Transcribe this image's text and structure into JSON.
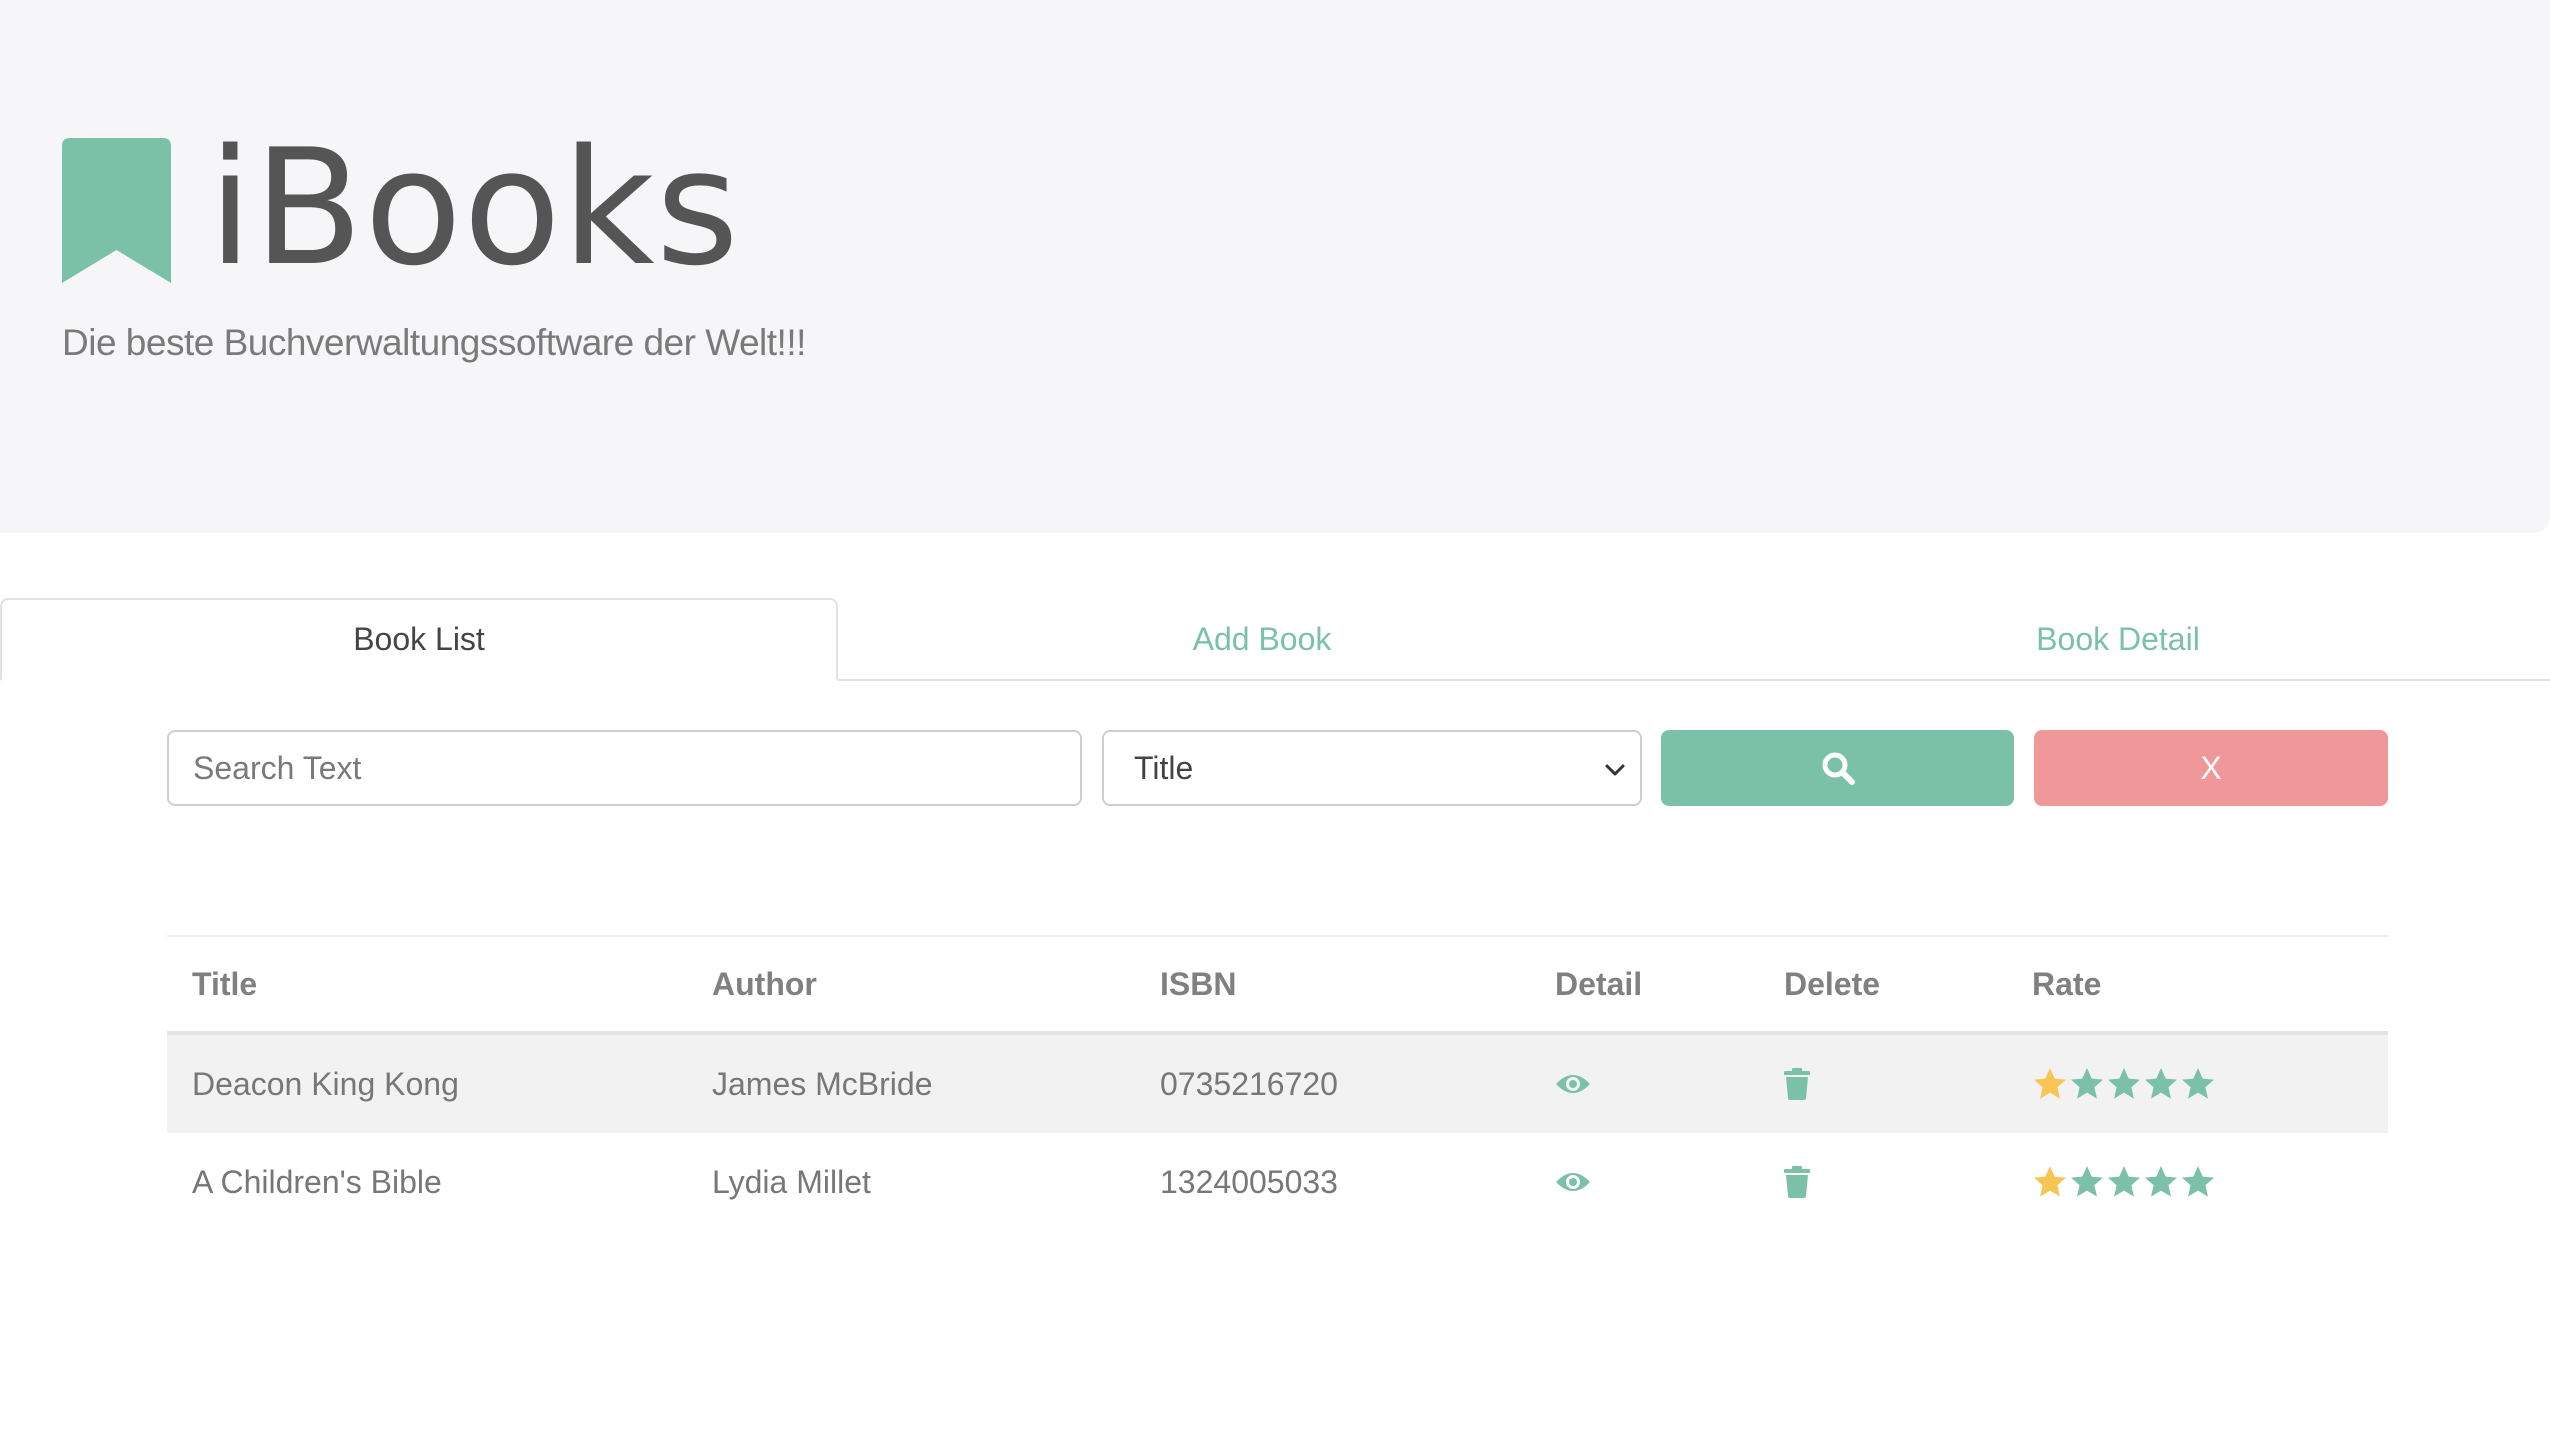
{
  "header": {
    "app_title": "iBooks",
    "tagline": "Die beste Buchverwaltungssoftware der Welt!!!",
    "logo_icon": "bookmark-icon"
  },
  "tabs": [
    {
      "label": "Book List",
      "active": true
    },
    {
      "label": "Add Book",
      "active": false
    },
    {
      "label": "Book Detail",
      "active": false
    }
  ],
  "search": {
    "placeholder": "Search Text",
    "value": "",
    "field_selected": "Title",
    "search_button_icon": "search-icon",
    "clear_label": "X"
  },
  "table": {
    "headers": {
      "title": "Title",
      "author": "Author",
      "isbn": "ISBN",
      "detail": "Detail",
      "delete": "Delete",
      "rate": "Rate"
    },
    "rows": [
      {
        "title": "Deacon King Kong",
        "author": "James McBride",
        "isbn": "0735216720",
        "rating": 1,
        "max_rating": 5
      },
      {
        "title": "A Children's Bible",
        "author": "Lydia Millet",
        "isbn": "1324005033",
        "rating": 1,
        "max_rating": 5
      }
    ]
  },
  "colors": {
    "accent": "#7ac1a8",
    "danger": "#f0979a",
    "star_filled": "#f8c555",
    "star_empty": "#7ac1a8",
    "hero_bg": "#f6f6f8"
  }
}
